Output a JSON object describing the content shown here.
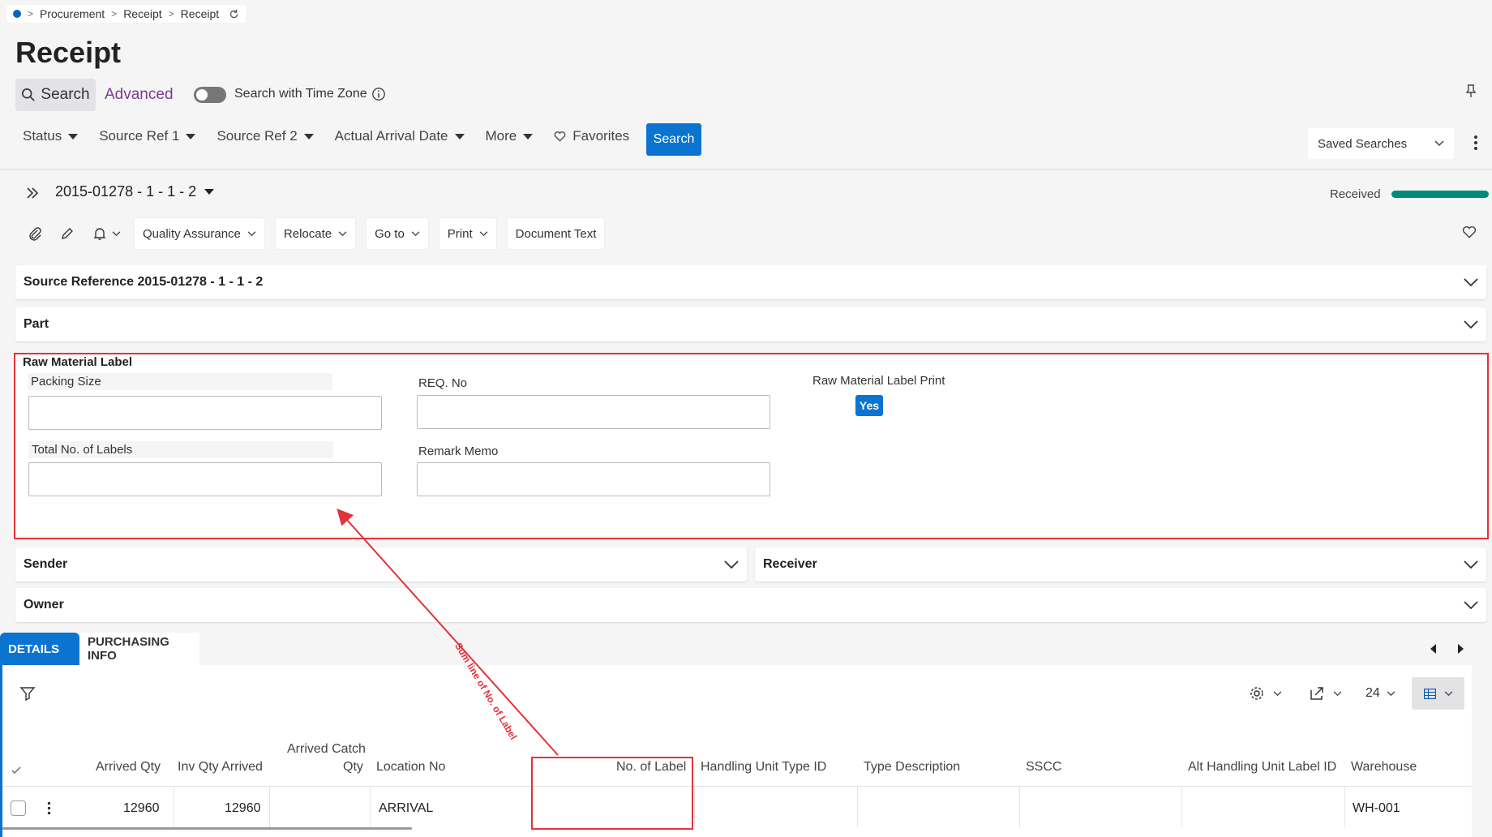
{
  "breadcrumb": [
    "Procurement",
    "Receipt",
    "Receipt"
  ],
  "page_title": "Receipt",
  "search_bar": {
    "search_label": "Search",
    "advanced_label": "Advanced",
    "timezone_label": "Search with Time Zone"
  },
  "filters": [
    "Status",
    "Source Ref 1",
    "Source Ref 2",
    "Actual Arrival Date",
    "More"
  ],
  "favorites_label": "Favorites",
  "search_button": "Search",
  "saved_searches": "Saved Searches",
  "record": {
    "title": "2015-01278 - 1 - 1 - 2",
    "status": "Received",
    "progress": 1.0
  },
  "toolbar": {
    "quality_assurance": "Quality Assurance",
    "relocate": "Relocate",
    "go_to": "Go to",
    "print": "Print",
    "document_text": "Document Text"
  },
  "sections": {
    "source_reference": "Source Reference 2015-01278 - 1 - 1 - 2",
    "part": "Part",
    "sender": "Sender",
    "receiver": "Receiver",
    "owner": "Owner"
  },
  "raw_material": {
    "title": "Raw Material Label",
    "packing_size_label": "Packing Size",
    "packing_size_value": "",
    "req_no_label": "REQ. No",
    "req_no_value": "",
    "label_print_label": "Raw Material Label Print",
    "label_print_value": "Yes",
    "total_labels_label": "Total No. of Labels",
    "total_labels_value": "",
    "remark_memo_label": "Remark Memo",
    "remark_memo_value": ""
  },
  "annotation": "Sum line of No. of Label",
  "tabs": [
    "DETAILS",
    "PURCHASING INFO"
  ],
  "grid": {
    "page_size": "24",
    "headers": {
      "arrived_qty": "Arrived Qty",
      "inv_qty_arrived": "Inv Qty Arrived",
      "arrived_catch_qty_1": "Arrived Catch",
      "arrived_catch_qty_2": "Qty",
      "location_no": "Location No",
      "no_of_label": "No. of Label",
      "handling_unit_type_id": "Handling Unit Type ID",
      "type_description": "Type Description",
      "sscc": "SSCC",
      "alt_handling_unit_label_id": "Alt Handling Unit Label ID",
      "warehouse": "Warehouse"
    },
    "rows": [
      {
        "arrived_qty": "12960",
        "inv_qty_arrived": "12960",
        "arrived_catch_qty": "",
        "location_no": "ARRIVAL",
        "no_of_label": "",
        "handling_unit_type_id": "",
        "type_description": "",
        "sscc": "",
        "alt_handling_unit_label_id": "",
        "warehouse": "WH-001"
      }
    ]
  },
  "colors": {
    "accent": "#0b74d1",
    "annotation_red": "#e2333b",
    "progress_teal": "#008a7a",
    "advanced_purple": "#7b3b94"
  }
}
